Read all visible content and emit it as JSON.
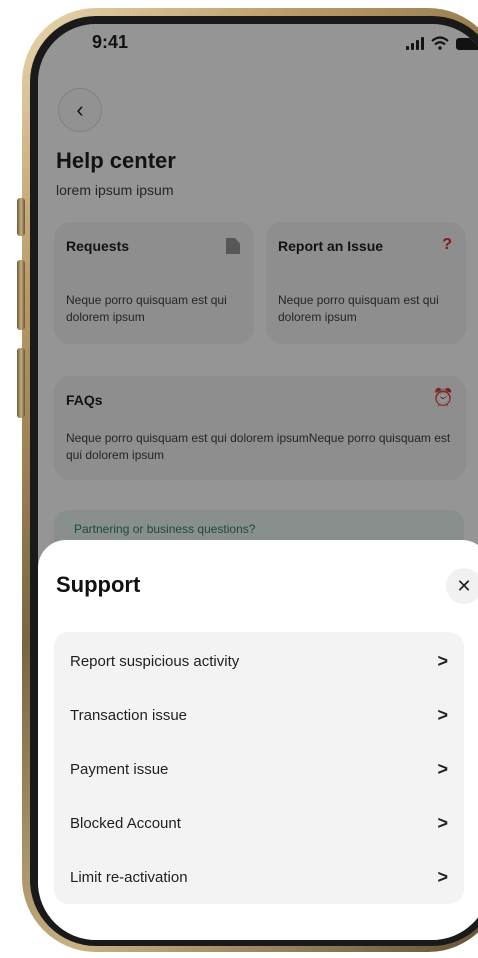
{
  "status_bar": {
    "time": "9:41"
  },
  "help_center": {
    "back_icon": "chevron-left-icon",
    "title": "Help center",
    "subtitle": "lorem ipsum ipsum",
    "cards": [
      {
        "title": "Requests",
        "description": "Neque porro quisquam est qui dolorem ipsum",
        "icon": "document-icon"
      },
      {
        "title": "Report an Issue",
        "description": "Neque porro quisquam est qui dolorem ipsum",
        "icon": "question-icon",
        "icon_glyph": "?",
        "icon_color": "#e02020"
      },
      {
        "title": "FAQs",
        "description": "Neque porro quisquam est qui dolorem ipsumNeque porro quisquam est qui dolorem ipsum",
        "icon": "alarm-clock-icon",
        "icon_glyph": "⏰",
        "icon_color": "#e35b5b"
      }
    ],
    "partner_text": "Partnering or business questions?"
  },
  "support_sheet": {
    "title": "Support",
    "close_glyph": "✕",
    "chevron_glyph": ">",
    "items": [
      {
        "label": "Report suspicious activity"
      },
      {
        "label": "Transaction issue"
      },
      {
        "label": "Payment issue"
      },
      {
        "label": "Blocked Account"
      },
      {
        "label": "Limit re-activation"
      }
    ]
  },
  "colors": {
    "overlay": "#141414",
    "partner_background": "#e7f4ef",
    "partner_text": "#1e7a5c"
  }
}
